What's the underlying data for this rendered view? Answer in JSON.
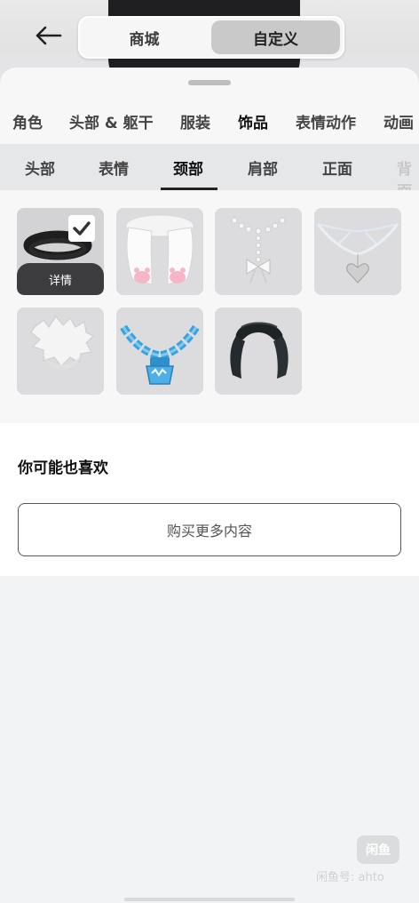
{
  "header": {
    "tabs": [
      {
        "label": "商城",
        "active": false
      },
      {
        "label": "自定义",
        "active": true
      }
    ]
  },
  "categories": [
    {
      "label": "角色",
      "active": false
    },
    {
      "label": "头部 & 躯干",
      "active": false
    },
    {
      "label": "服装",
      "active": false
    },
    {
      "label": "饰品",
      "active": true
    },
    {
      "label": "表情动作",
      "active": false
    },
    {
      "label": "动画",
      "active": false
    }
  ],
  "subcategories": [
    {
      "label": "头部",
      "active": false
    },
    {
      "label": "表情",
      "active": false
    },
    {
      "label": "颈部",
      "active": true
    },
    {
      "label": "肩部",
      "active": false
    },
    {
      "label": "正面",
      "active": false
    },
    {
      "label": "背面",
      "active": false
    }
  ],
  "items": [
    {
      "icon": "black-choker-icon",
      "selected": true
    },
    {
      "icon": "white-cat-paw-scarf-icon",
      "selected": false
    },
    {
      "icon": "pearl-bow-necklace-icon",
      "selected": false
    },
    {
      "icon": "ribbon-heart-necklace-icon",
      "selected": false
    },
    {
      "icon": "white-fur-collar-icon",
      "selected": false
    },
    {
      "icon": "blue-chain-necklace-icon",
      "selected": false
    },
    {
      "icon": "black-scarf-icon",
      "selected": false
    }
  ],
  "selected_item": {
    "detail_label": "详情"
  },
  "recommend": {
    "title": "你可能也喜欢",
    "button_label": "购买更多内容"
  },
  "watermark": {
    "logo_text": "闲鱼",
    "text": "闲鱼号: ahto"
  },
  "colors": {
    "sheet": "#f7f7f8",
    "subbar": "#e6e7e9",
    "tile": "#dcdcde",
    "detail": "#3c3c3e"
  }
}
